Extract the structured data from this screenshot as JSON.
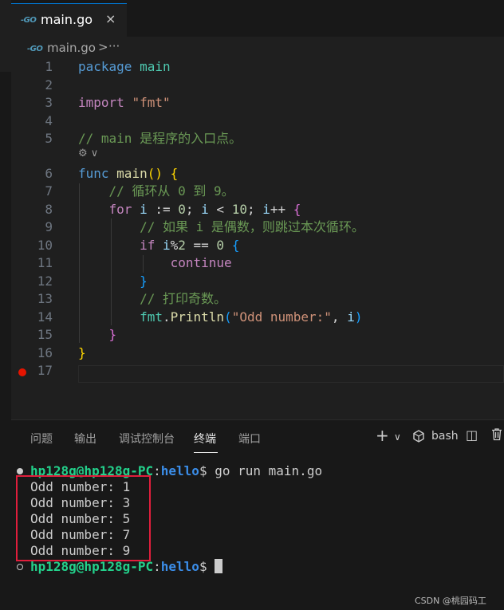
{
  "tab": {
    "icon": "go-file-icon",
    "title": "main.go",
    "close": "×"
  },
  "breadcrumb": {
    "file": "main.go",
    "separator": ">",
    "more": "···"
  },
  "codelens": {
    "text": "⚙ ∨"
  },
  "code_lines": [
    {
      "n": "1",
      "segments": [
        {
          "t": "package ",
          "c": "kw"
        },
        {
          "t": "main",
          "c": "pkgname"
        }
      ]
    },
    {
      "n": "2",
      "segments": []
    },
    {
      "n": "3",
      "segments": [
        {
          "t": "import ",
          "c": "kw2"
        },
        {
          "t": "\"fmt\"",
          "c": "str"
        }
      ]
    },
    {
      "n": "4",
      "segments": []
    },
    {
      "n": "5",
      "segments": [
        {
          "t": "// main 是程序的入口点。",
          "c": "cmt"
        }
      ]
    },
    {
      "n": "6",
      "segments": [
        {
          "t": "func ",
          "c": "kw"
        },
        {
          "t": "main",
          "c": "fn"
        },
        {
          "t": "()",
          "c": "br"
        },
        {
          "t": " ",
          "c": "op"
        },
        {
          "t": "{",
          "c": "br"
        }
      ]
    },
    {
      "n": "7",
      "segments": [
        {
          "t": "    // 循环从 0 到 9。",
          "c": "cmt"
        }
      ]
    },
    {
      "n": "8",
      "segments": [
        {
          "t": "    for ",
          "c": "kw2"
        },
        {
          "t": "i",
          "c": "var"
        },
        {
          "t": " := ",
          "c": "op"
        },
        {
          "t": "0",
          "c": "num"
        },
        {
          "t": "; ",
          "c": "op"
        },
        {
          "t": "i",
          "c": "var"
        },
        {
          "t": " < ",
          "c": "op"
        },
        {
          "t": "10",
          "c": "num"
        },
        {
          "t": "; ",
          "c": "op"
        },
        {
          "t": "i",
          "c": "var"
        },
        {
          "t": "++ ",
          "c": "op"
        },
        {
          "t": "{",
          "c": "br2"
        }
      ]
    },
    {
      "n": "9",
      "segments": [
        {
          "t": "        // 如果 i 是偶数，则跳过本次循环。",
          "c": "cmt"
        }
      ]
    },
    {
      "n": "10",
      "segments": [
        {
          "t": "        if ",
          "c": "kw2"
        },
        {
          "t": "i",
          "c": "var"
        },
        {
          "t": "%",
          "c": "op"
        },
        {
          "t": "2",
          "c": "num"
        },
        {
          "t": " == ",
          "c": "op"
        },
        {
          "t": "0",
          "c": "num"
        },
        {
          "t": " ",
          "c": "op"
        },
        {
          "t": "{",
          "c": "br3"
        }
      ]
    },
    {
      "n": "11",
      "segments": [
        {
          "t": "            continue",
          "c": "kw2"
        }
      ]
    },
    {
      "n": "12",
      "segments": [
        {
          "t": "        ",
          "c": "op"
        },
        {
          "t": "}",
          "c": "br3"
        }
      ]
    },
    {
      "n": "13",
      "segments": [
        {
          "t": "        // 打印奇数。",
          "c": "cmt"
        }
      ]
    },
    {
      "n": "14",
      "segments": [
        {
          "t": "        fmt",
          "c": "pkg"
        },
        {
          "t": ".",
          "c": "op"
        },
        {
          "t": "Println",
          "c": "fn"
        },
        {
          "t": "(",
          "c": "br3"
        },
        {
          "t": "\"Odd number:\"",
          "c": "str"
        },
        {
          "t": ", ",
          "c": "op"
        },
        {
          "t": "i",
          "c": "var"
        },
        {
          "t": ")",
          "c": "br3"
        }
      ]
    },
    {
      "n": "15",
      "segments": [
        {
          "t": "    ",
          "c": "op"
        },
        {
          "t": "}",
          "c": "br2"
        }
      ]
    },
    {
      "n": "16",
      "segments": [
        {
          "t": "}",
          "c": "br"
        }
      ]
    },
    {
      "n": "17",
      "segments": []
    }
  ],
  "panel": {
    "tabs": [
      {
        "label": "问题",
        "active": false
      },
      {
        "label": "输出",
        "active": false
      },
      {
        "label": "调试控制台",
        "active": false
      },
      {
        "label": "终端",
        "active": true
      },
      {
        "label": "端口",
        "active": false
      }
    ],
    "actions": {
      "add": "+",
      "dropdown": "∨",
      "shell_icon": "terminal-shell-icon",
      "shell": "bash",
      "split": "◫",
      "trash": "🗑"
    }
  },
  "terminal": {
    "user": "hp128g@hp128g-PC",
    "colon": ":",
    "path": "hello",
    "prompt": "$",
    "command": "go run main.go",
    "output": [
      "Odd number: 1",
      "Odd number: 3",
      "Odd number: 5",
      "Odd number: 7",
      "Odd number: 9"
    ]
  },
  "watermark": "CSDN @桃园码工"
}
